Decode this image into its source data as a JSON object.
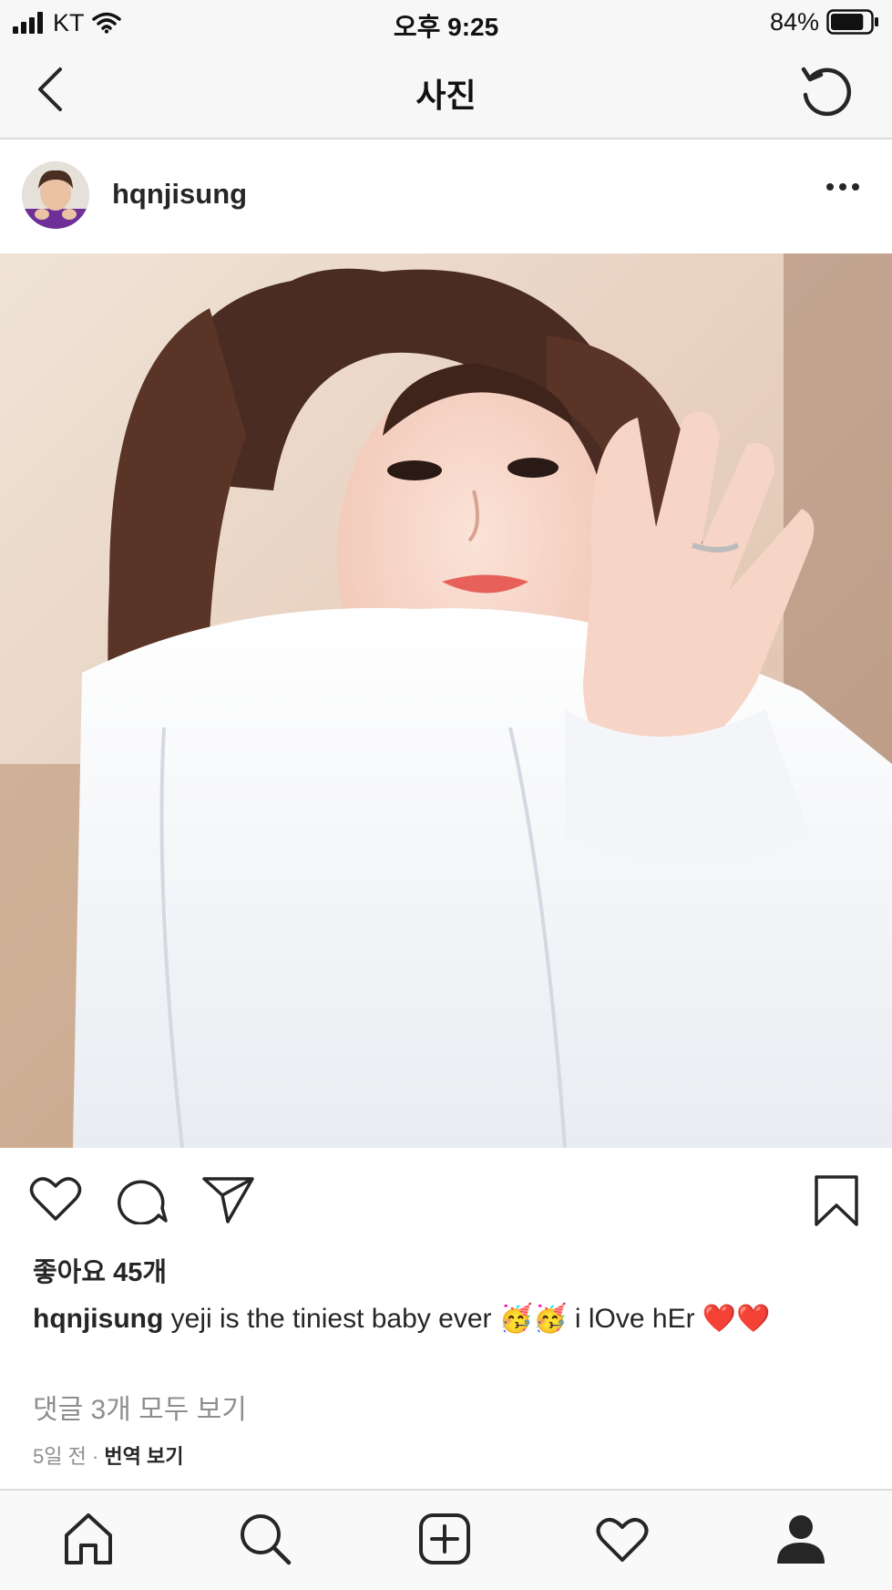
{
  "status_bar": {
    "carrier": "KT",
    "time": "오후 9:25",
    "battery_percent": "84%",
    "battery_level": 0.84
  },
  "nav": {
    "title": "사진",
    "back_icon": "chevron-left-icon",
    "refresh_icon": "refresh-icon"
  },
  "post": {
    "username": "hqnjisung",
    "likes": "좋아요 45개",
    "caption_user": "hqnjisung",
    "caption_text": " yeji is the tiniest baby ever 🥳🥳 i lOve hEr ❤️❤️",
    "view_comments": "댓글 3개 모두 보기",
    "time_ago": "5일 전",
    "separator": " · ",
    "translate": "번역 보기"
  },
  "actions": [
    "heart-icon",
    "comment-icon",
    "share-icon",
    "bookmark-icon"
  ],
  "tabs": [
    "home-icon",
    "search-icon",
    "add-post-icon",
    "activity-heart-icon",
    "profile-icon"
  ],
  "colors": {
    "text": "#262626",
    "secondary_text": "#8e8e8e",
    "bar_background": "#f7f7f7",
    "divider": "#dbdbdb"
  }
}
